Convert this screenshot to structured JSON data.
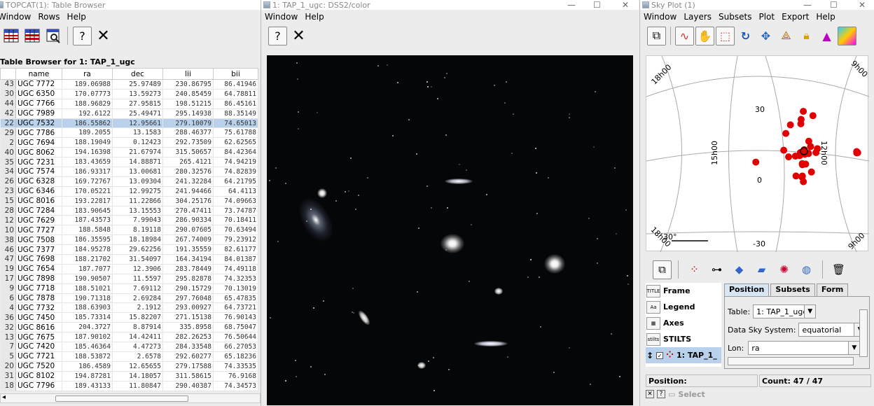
{
  "colors": {
    "selection": "#b9d1ea",
    "marker": "#e00000",
    "sky_bg": "#050608"
  },
  "left": {
    "title": "TOPCAT(1): Table Browser",
    "menu": [
      "Window",
      "Rows",
      "Help"
    ],
    "table_title": "Table Browser for 1: TAP_1_ugc",
    "columns": [
      "",
      "name",
      "ra",
      "dec",
      "lii",
      "bii"
    ],
    "selected_index": 4,
    "rows": [
      [
        "43",
        "UGC 7772",
        "189.06988",
        "25.97489",
        "230.86795",
        "86.41946"
      ],
      [
        "30",
        "UGC 6350",
        "170.07773",
        "13.59273",
        "240.85459",
        "64.78811"
      ],
      [
        "44",
        "UGC 7766",
        "188.96829",
        "27.95815",
        "198.51215",
        "86.45161"
      ],
      [
        "42",
        "UGC 7989",
        "192.6122",
        "25.49471",
        "295.14938",
        "88.35149"
      ],
      [
        "22",
        "UGC 7532",
        "186.55862",
        "12.95661",
        "279.10079",
        "74.65013"
      ],
      [
        "29",
        "UGC 7786",
        "189.2055",
        "13.1583",
        "288.46377",
        "75.61788"
      ],
      [
        "2",
        "UGC 7694",
        "188.19049",
        "0.12423",
        "292.73509",
        "62.62565"
      ],
      [
        "40",
        "UGC 8062",
        "194.16398",
        "21.67974",
        "315.50657",
        "84.42364"
      ],
      [
        "35",
        "UGC 7231",
        "183.43659",
        "14.88871",
        "265.4121",
        "74.94219"
      ],
      [
        "34",
        "UGC 7574",
        "186.93317",
        "13.00681",
        "280.32576",
        "74.82839"
      ],
      [
        "26",
        "UGC 6328",
        "169.72767",
        "13.09304",
        "241.32284",
        "64.21795"
      ],
      [
        "23",
        "UGC 6346",
        "170.05221",
        "12.99275",
        "241.94466",
        "64.4113"
      ],
      [
        "15",
        "UGC 8016",
        "193.22817",
        "11.22866",
        "304.25176",
        "74.09663"
      ],
      [
        "28",
        "UGC 7284",
        "183.90645",
        "13.15553",
        "270.47411",
        "73.74787"
      ],
      [
        "12",
        "UGC 7629",
        "187.43573",
        "7.99043",
        "286.90334",
        "70.18411"
      ],
      [
        "10",
        "UGC 7727",
        "188.5848",
        "8.19118",
        "290.07605",
        "70.63494"
      ],
      [
        "38",
        "UGC 7508",
        "186.35595",
        "18.18984",
        "267.74009",
        "79.23912"
      ],
      [
        "46",
        "UGC 7377",
        "184.95278",
        "29.62256",
        "191.35559",
        "82.61177"
      ],
      [
        "47",
        "UGC 7698",
        "188.21702",
        "31.54097",
        "164.34194",
        "84.01387"
      ],
      [
        "19",
        "UGC 7654",
        "187.7077",
        "12.3906",
        "283.78449",
        "74.49118"
      ],
      [
        "17",
        "UGC 7898",
        "190.90507",
        "11.5597",
        "295.82878",
        "74.32353"
      ],
      [
        "9",
        "UGC 7718",
        "188.51021",
        "7.69112",
        "290.15729",
        "70.13019"
      ],
      [
        "6",
        "UGC 7878",
        "190.71318",
        "2.69284",
        "297.76048",
        "65.47835"
      ],
      [
        "4",
        "UGC 7732",
        "188.63903",
        "2.1912",
        "293.00927",
        "64.73721"
      ],
      [
        "36",
        "UGC 7450",
        "185.73314",
        "15.82207",
        "271.15138",
        "76.90143"
      ],
      [
        "32",
        "UGC 8616",
        "204.3727",
        "8.87914",
        "335.8958",
        "68.75047"
      ],
      [
        "13",
        "UGC 7675",
        "187.90102",
        "14.42411",
        "282.26253",
        "76.50644"
      ],
      [
        "7",
        "UGC 7420",
        "185.46364",
        "4.47273",
        "284.33548",
        "66.27053"
      ],
      [
        "5",
        "UGC 7721",
        "188.53872",
        "2.6578",
        "292.60277",
        "65.18236"
      ],
      [
        "20",
        "UGC 7520",
        "186.4589",
        "12.65655",
        "279.17588",
        "74.33535"
      ],
      [
        "31",
        "UGC 8102",
        "194.87281",
        "14.18057",
        "311.58615",
        "76.9168"
      ],
      [
        "18",
        "UGC 7796",
        "189.43133",
        "11.80847",
        "290.40387",
        "74.34573"
      ]
    ]
  },
  "middle": {
    "title": "1: TAP_1_ugc: DSS2/color",
    "menu": [
      "Window",
      "Help"
    ]
  },
  "right": {
    "title": "Sky Plot (1)",
    "menu": [
      "Window",
      "Layers",
      "Subsets",
      "Plot",
      "Export",
      "Help"
    ],
    "axis_labels": {
      "tl": "18h00",
      "tr": "9h00",
      "bl": "18h00",
      "br": "9h00",
      "mid_left": "15h00",
      "mid_right": "12h00",
      "dec_30": "30",
      "dec_0": "0",
      "dec_m30": "-30",
      "scale": "30°"
    },
    "layers": [
      "Frame",
      "Legend",
      "Axes",
      "STILTS",
      "1: TAP_1_"
    ],
    "tabs": [
      "Position",
      "Subsets",
      "Form"
    ],
    "table_label": "Table:",
    "table_value": "1: TAP_1_ugc",
    "sky_label": "Data Sky System:",
    "sky_value": "equatorial",
    "lon_label": "Lon:",
    "lon_value": "ra",
    "position_label": "Position:",
    "count_label": "Count: 47 / 47",
    "select_label": "Select"
  }
}
